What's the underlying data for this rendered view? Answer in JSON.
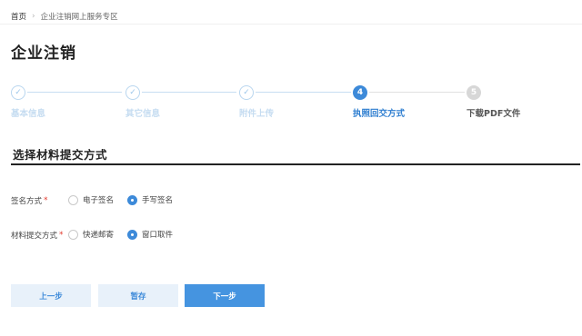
{
  "breadcrumb": {
    "home": "首页",
    "separator": "›",
    "current": "企业注销网上服务专区"
  },
  "page_title": "企业注销",
  "steps": [
    {
      "label": "基本信息",
      "state": "done",
      "icon": "check-icon",
      "glyph": "✓"
    },
    {
      "label": "其它信息",
      "state": "done",
      "icon": "check-icon",
      "glyph": "✓"
    },
    {
      "label": "附件上传",
      "state": "done",
      "icon": "check-icon",
      "glyph": "✓"
    },
    {
      "label": "执照回交方式",
      "state": "active",
      "number": "4"
    },
    {
      "label": "下载PDF文件",
      "state": "todo",
      "number": "5"
    }
  ],
  "section_title": "选择材料提交方式",
  "form": {
    "sign_method": {
      "label": "签名方式",
      "required_mark": "*",
      "options": [
        "电子签名",
        "手写签名"
      ],
      "selected": "手写签名"
    },
    "submit_method": {
      "label": "材料提交方式",
      "required_mark": "*",
      "options": [
        "快递邮寄",
        "窗口取件"
      ],
      "selected": "窗口取件"
    }
  },
  "buttons": {
    "prev": "上一步",
    "save": "暂存",
    "next": "下一步"
  },
  "colors": {
    "accent": "#3d8ad9",
    "primary_button": "#4594e0",
    "light_button": "#e8f1fa",
    "required": "#e23a2e",
    "done_step": "#9cc6ea",
    "todo_step": "#d7d7d7"
  }
}
